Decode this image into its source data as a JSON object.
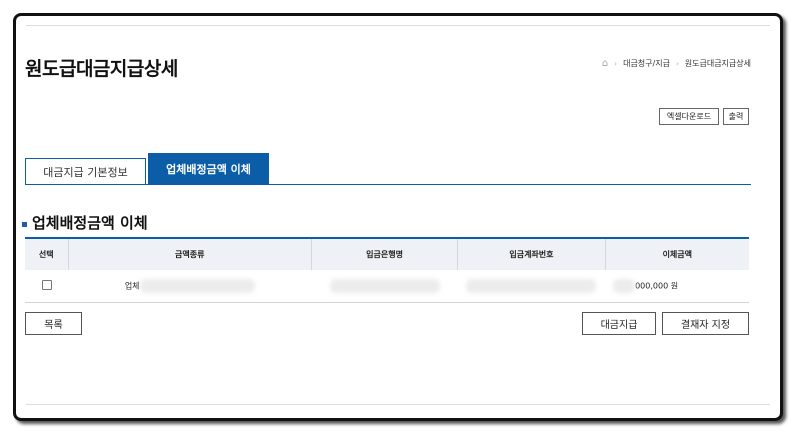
{
  "page": {
    "title": "원도급대금지급상세",
    "breadcrumb": [
      "대금청구/지급",
      "원도급대금지급상세"
    ]
  },
  "toolbar": {
    "excel_label": "엑셀다운로드",
    "print_label": "출력"
  },
  "tabs": [
    {
      "label": "대금지급 기본정보",
      "active": false
    },
    {
      "label": "업체배정금액 이체",
      "active": true
    }
  ],
  "section": {
    "title": "업체배정금액 이체"
  },
  "table": {
    "headers": [
      "선택",
      "금액종류",
      "입금은행명",
      "입금계좌번호",
      "이체금액"
    ],
    "rows": [
      {
        "type": "업체",
        "bank": "",
        "account": "",
        "amount": "000,000 원"
      }
    ]
  },
  "actions": {
    "list_label": "목록",
    "pay_label": "대금지급",
    "approver_label": "결재자 지정"
  },
  "colors": {
    "accent": "#0b5da8",
    "header_bg": "#eef1f5"
  }
}
